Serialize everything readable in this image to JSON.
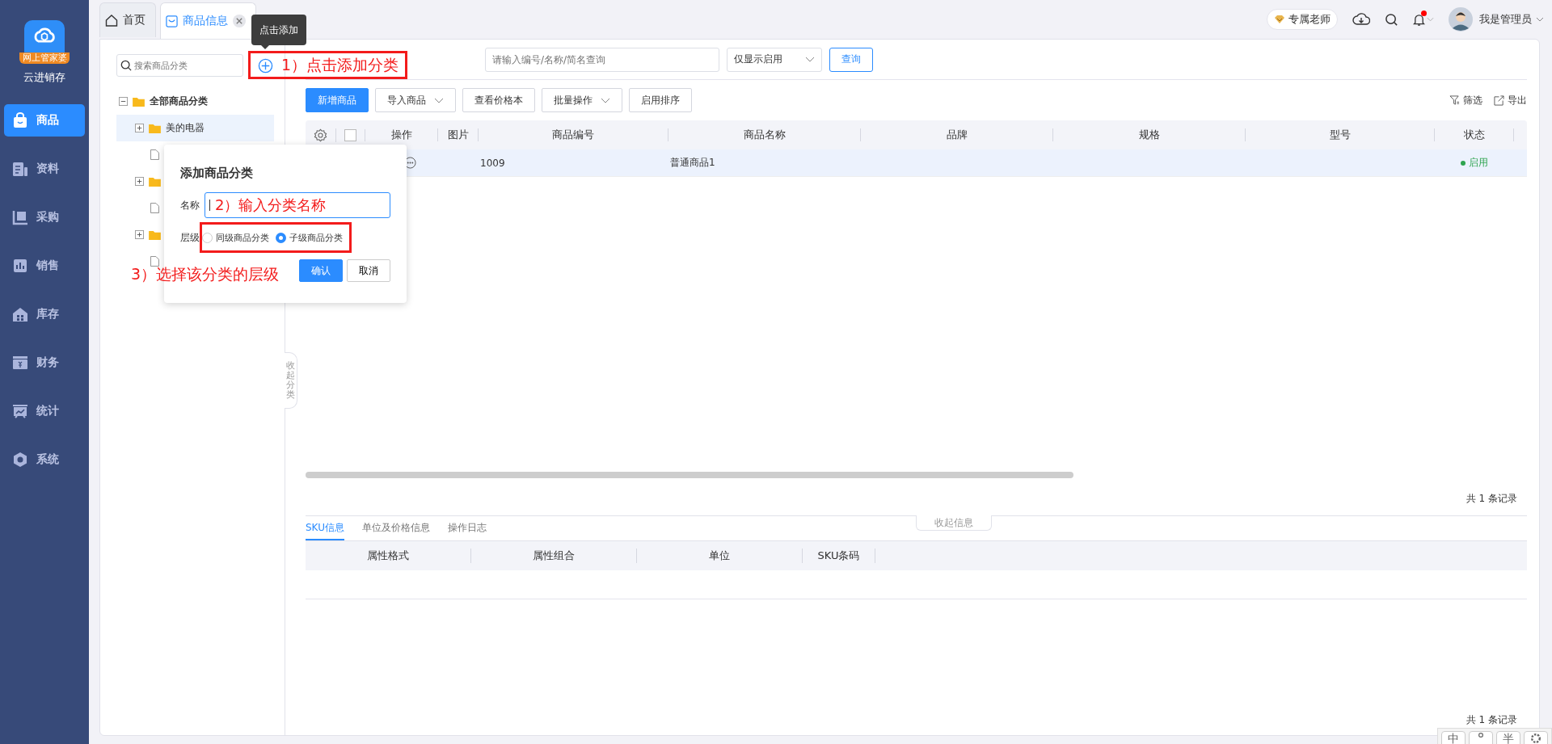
{
  "app": {
    "logo_badge": "网上管家婆",
    "name": "云进销存"
  },
  "sidebar": {
    "items": [
      {
        "label": "商品",
        "kind": "bag",
        "selected": true
      },
      {
        "label": "资料",
        "kind": "doc",
        "selected": false
      },
      {
        "label": "采购",
        "kind": "cart",
        "selected": false
      },
      {
        "label": "销售",
        "kind": "chart",
        "selected": false
      },
      {
        "label": "库存",
        "kind": "house",
        "selected": false
      },
      {
        "label": "财务",
        "kind": "money",
        "selected": false
      },
      {
        "label": "统计",
        "kind": "trend",
        "selected": false
      },
      {
        "label": "系统",
        "kind": "hex",
        "selected": false
      }
    ]
  },
  "tabs": [
    {
      "label": "首页",
      "kind": "home",
      "selected": false,
      "closable": false
    },
    {
      "label": "商品信息",
      "kind": "page",
      "selected": true,
      "closable": true
    }
  ],
  "header": {
    "teacher": "专属老师",
    "notification_dot": true,
    "user": "我是管理员"
  },
  "tooltip": "点击添加",
  "category_panel": {
    "search_placeholder": "搜索商品分类",
    "annotation": "1）点击添加分类",
    "collapse_tab": "收起分类",
    "tree": [
      {
        "label": "全部商品分类",
        "kind": "folder",
        "expanded": true,
        "selected": false,
        "children": [
          {
            "label": "美的电器",
            "kind": "folder",
            "expanded": false,
            "selected": true
          },
          {
            "kind": "file",
            "selected": false
          },
          {
            "kind": "folder",
            "expanded": false,
            "selected": false
          },
          {
            "kind": "file",
            "selected": false
          },
          {
            "kind": "folder",
            "expanded": false,
            "selected": false
          },
          {
            "kind": "file",
            "selected": false
          }
        ]
      }
    ]
  },
  "add_dialog": {
    "title": "添加商品分类",
    "name_label": "名称",
    "name_annotation": "2）输入分类名称",
    "level_label": "层级",
    "level_highlighted": true,
    "levels": [
      {
        "label": "同级商品分类",
        "selected": false
      },
      {
        "label": "子级商品分类",
        "selected": true
      }
    ],
    "annotation": "3）选择该分类的层级",
    "buttons": [
      {
        "label": "确认",
        "kind": "primary"
      },
      {
        "label": "取消",
        "kind": "plain"
      }
    ]
  },
  "filters": {
    "search_placeholder": "请输入编号/名称/简名查询",
    "status_select": "仅显示启用",
    "query_button": "查询"
  },
  "toolbar": {
    "buttons": [
      {
        "label": "新增商品",
        "kind": "primary"
      },
      {
        "label": "导入商品",
        "kind": "dropdown"
      },
      {
        "label": "查看价格本",
        "kind": "plain"
      },
      {
        "label": "批量操作",
        "kind": "dropdown"
      },
      {
        "label": "启用排序",
        "kind": "plain"
      }
    ],
    "actions": [
      {
        "label": "筛选",
        "kind": "filter"
      },
      {
        "label": "导出",
        "kind": "export"
      }
    ]
  },
  "table": {
    "select_all_checked": false,
    "columns": [
      "操作",
      "图片",
      "商品编号",
      "商品名称",
      "品牌",
      "规格",
      "型号",
      "状态"
    ],
    "rows": [
      {
        "code": "1009",
        "name": "普通商品1",
        "status": "启用",
        "selected": true
      }
    ],
    "total": "共 1 条记录"
  },
  "detail": {
    "tabs": [
      {
        "label": "SKU信息",
        "selected": true
      },
      {
        "label": "单位及价格信息",
        "selected": false
      },
      {
        "label": "操作日志",
        "selected": false
      }
    ],
    "collapse_tab": "收起信息",
    "columns": [
      "属性格式",
      "属性组合",
      "单位",
      "SKU条码"
    ],
    "total": "共 1 条记录"
  },
  "ime_bar": {
    "keys": [
      {
        "label": "中",
        "kind": "text"
      },
      {
        "kind": "punct"
      },
      {
        "label": "半",
        "kind": "text"
      },
      {
        "kind": "gear"
      }
    ]
  }
}
